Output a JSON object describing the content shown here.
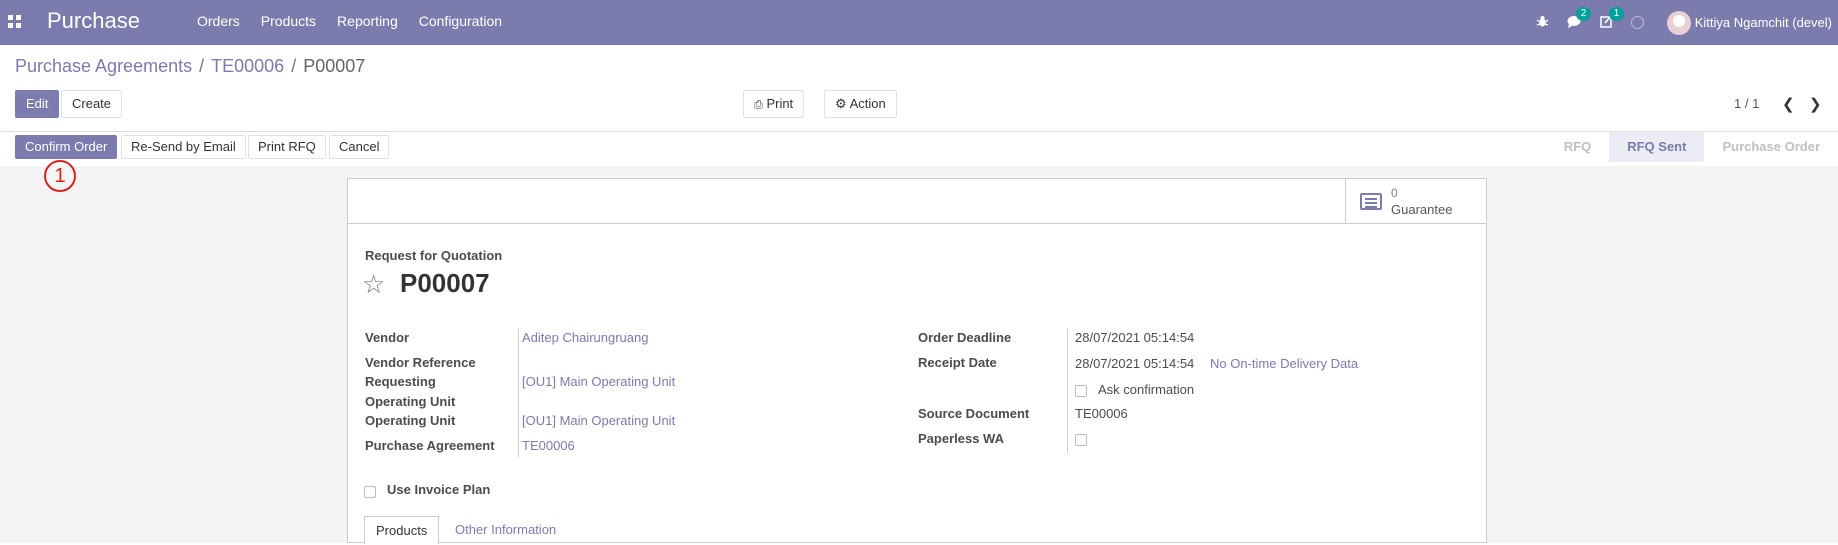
{
  "navbar": {
    "app_name": "Purchase",
    "menu": [
      "Orders",
      "Products",
      "Reporting",
      "Configuration"
    ],
    "messages_count": "2",
    "activities_count": "1",
    "user_name": "Kittiya Ngamchit (devel)"
  },
  "breadcrumb": {
    "items": [
      "Purchase Agreements",
      "TE00006"
    ],
    "current": "P00007",
    "separator": "/"
  },
  "toolbar": {
    "edit_label": "Edit",
    "create_label": "Create",
    "print_label": "Print",
    "action_label": "Action",
    "pager": "1 / 1"
  },
  "statusbar": {
    "buttons": [
      "Confirm Order",
      "Re-Send by Email",
      "Print RFQ",
      "Cancel"
    ],
    "stages": [
      "RFQ",
      "RFQ Sent",
      "Purchase Order"
    ],
    "current_stage": "RFQ Sent"
  },
  "annotation": "1",
  "form": {
    "smart_button": {
      "value": "0",
      "label": "Guarantee"
    },
    "doc_type": "Request for Quotation",
    "doc_name": "P00007",
    "left": {
      "vendor_label": "Vendor",
      "vendor_value": "Aditep Chairungruang",
      "vendor_ref_label": "Vendor Reference",
      "req_ou_label_1": "Requesting",
      "req_ou_label_2": "Operating Unit",
      "req_ou_value": "[OU1] Main Operating Unit",
      "ou_label": "Operating Unit",
      "ou_value": "[OU1] Main Operating Unit",
      "agreement_label": "Purchase Agreement",
      "agreement_value": "TE00006"
    },
    "right": {
      "deadline_label": "Order Deadline",
      "deadline_value": "28/07/2021 05:14:54",
      "receipt_label": "Receipt Date",
      "receipt_value": "28/07/2021 05:14:54",
      "on_time_label": "No On-time Delivery Data",
      "ask_confirmation_label": "Ask confirmation",
      "source_label": "Source Document",
      "source_value": "TE00006",
      "paperless_label": "Paperless WA"
    },
    "invoice_plan_label": "Use Invoice Plan",
    "tabs": [
      "Products",
      "Other Information"
    ]
  },
  "colors": {
    "brand": "#7c7bad",
    "badge": "#00a09d",
    "annotation": "#d9231f"
  }
}
